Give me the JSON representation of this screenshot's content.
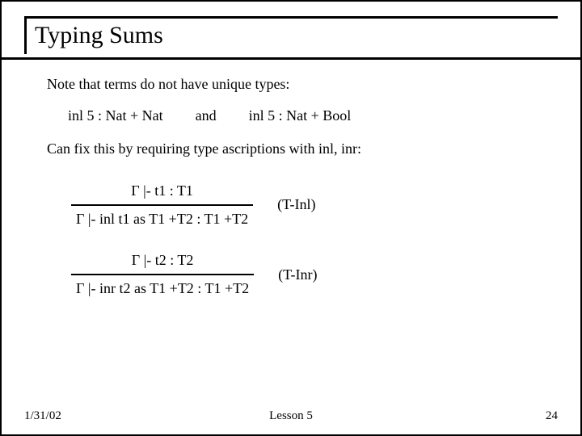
{
  "title": "Typing Sums",
  "note": "Note that terms do not have unique types:",
  "example1": "inl 5 : Nat + Nat",
  "example_and": "and",
  "example2": "inl 5 : Nat + Bool",
  "fix": "Can fix this by requiring type ascriptions with inl, inr:",
  "rule_inl": {
    "premise": "Γ |- t1 : T1",
    "conclusion": "Γ |- inl t1 as T1 +T2 : T1 +T2",
    "name": "(T-Inl)"
  },
  "rule_inr": {
    "premise": "Γ |- t2 : T2",
    "conclusion": "Γ |- inr t2 as T1 +T2 : T1 +T2",
    "name": "(T-Inr)"
  },
  "footer": {
    "date": "1/31/02",
    "lesson": "Lesson 5",
    "page": "24"
  }
}
